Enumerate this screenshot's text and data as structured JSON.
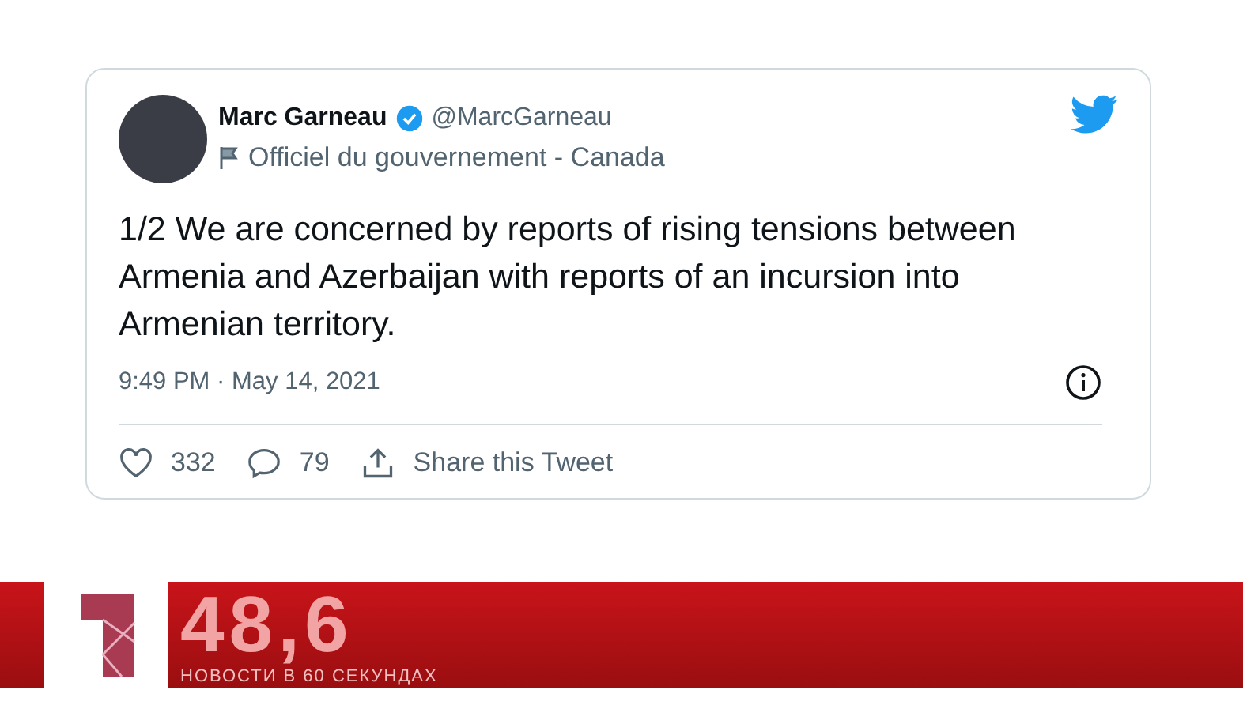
{
  "tweet": {
    "author": {
      "name": "Marc Garneau",
      "verified": true,
      "handle": "@MarcGarneau",
      "label": "Officiel du gouvernement - Canada"
    },
    "text": "1/2 We are concerned by reports of rising tensions between Armenia and Azerbaijan with reports of an incursion into Armenian territory.",
    "timestamp": "9:49 PM · May 14, 2021",
    "actions": [
      {
        "kind": "like",
        "label": "332"
      },
      {
        "kind": "reply",
        "label": "79"
      },
      {
        "kind": "share",
        "label": "Share this Tweet"
      }
    ]
  },
  "ticker": {
    "headline": "48,6",
    "caption": "НОВОСТИ В 60 СЕКУНДАХ"
  }
}
